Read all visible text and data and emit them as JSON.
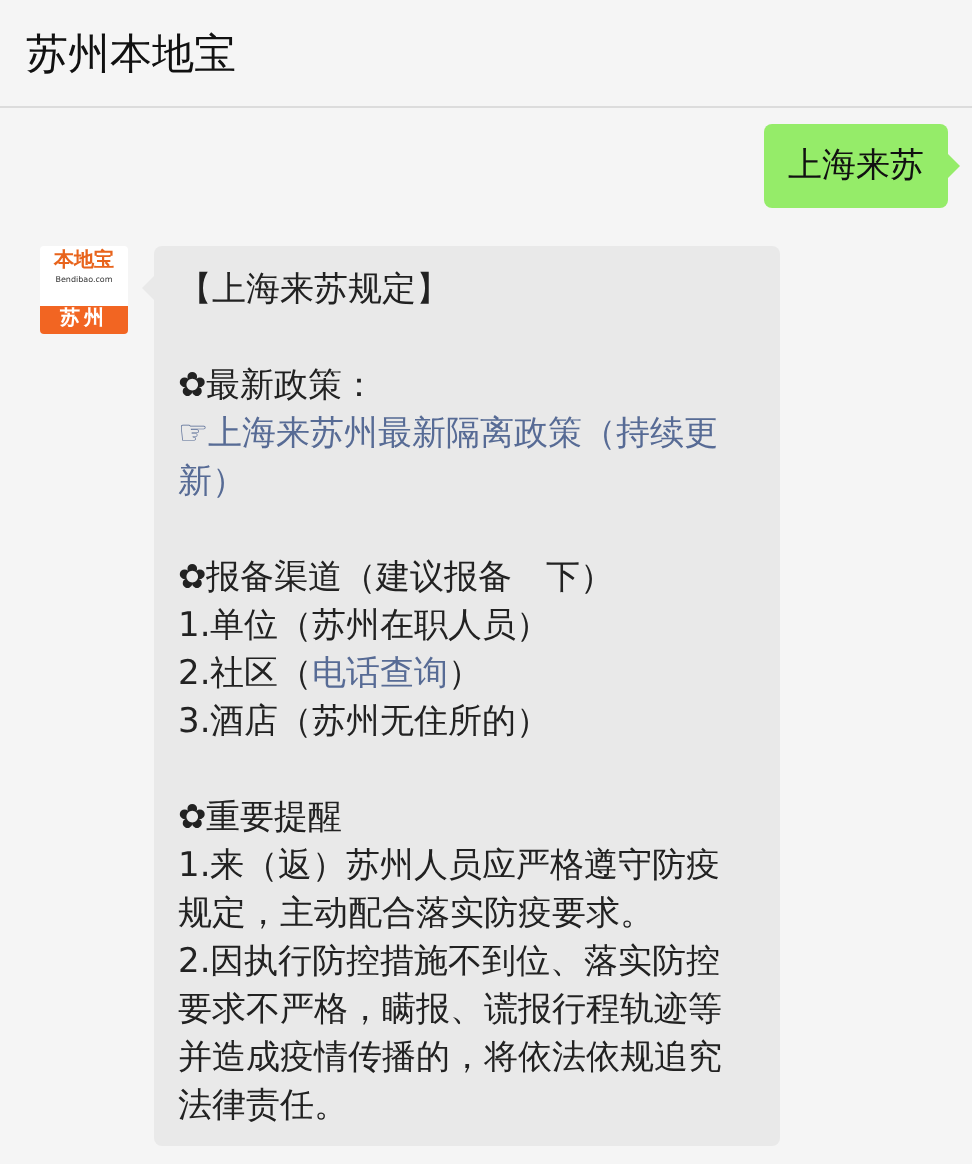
{
  "header": {
    "title": "苏州本地宝"
  },
  "messages": [
    {
      "kind": "outgoing",
      "text": "上海来苏"
    },
    {
      "kind": "incoming",
      "avatar": {
        "logo": "本地宝",
        "domain": "Bendibao.com",
        "city": "苏州"
      },
      "blocks": [
        [
          {
            "parts": [
              {
                "kind": "plain",
                "text": "【上海来苏规定】"
              }
            ]
          }
        ],
        [
          {
            "parts": [
              {
                "kind": "plain",
                "text": "✿最新政策："
              }
            ]
          },
          {
            "parts": [
              {
                "kind": "link",
                "text": "☞上海来苏州最新隔离政策（持续更新）"
              }
            ]
          }
        ],
        [
          {
            "parts": [
              {
                "kind": "plain",
                "text": "✿报备渠道（建议报备　下）"
              }
            ]
          },
          {
            "parts": [
              {
                "kind": "plain",
                "text": "1.单位（苏州在职人员）"
              }
            ]
          },
          {
            "parts": [
              {
                "kind": "plain",
                "text": "2.社区（"
              },
              {
                "kind": "link",
                "text": "电话查询"
              },
              {
                "kind": "plain",
                "text": "）"
              }
            ]
          },
          {
            "parts": [
              {
                "kind": "plain",
                "text": "3.酒店（苏州无住所的）"
              }
            ]
          }
        ],
        [
          {
            "parts": [
              {
                "kind": "plain",
                "text": "✿重要提醒"
              }
            ]
          },
          {
            "parts": [
              {
                "kind": "plain",
                "text": "1.来（返）苏州人员应严格遵守防疫规定，主动配合落实防疫要求。"
              }
            ]
          },
          {
            "parts": [
              {
                "kind": "plain",
                "text": "2.因执行防控措施不到位、落实防控要求不严格，瞒报、谎报行程轨迹等并造成疫情传播的，将依法依规追究法律责任。"
              }
            ]
          }
        ]
      ]
    }
  ]
}
